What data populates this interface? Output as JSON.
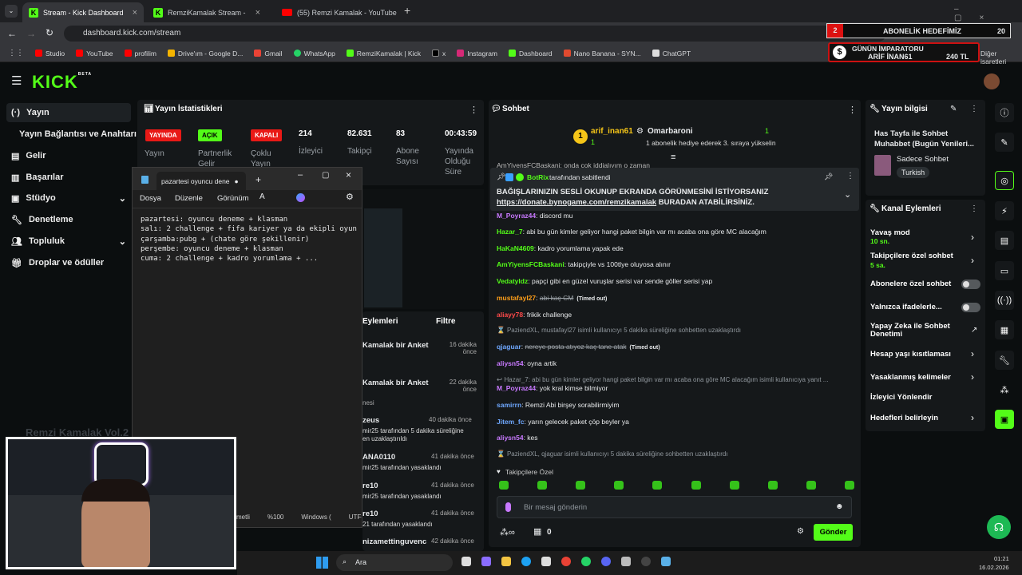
{
  "browser": {
    "tabs": [
      {
        "title": "Stream - Kick Dashboard"
      },
      {
        "title": "RemziKamalak Stream - Wa"
      },
      {
        "title": "(55) Remzi Kamalak - YouTube"
      }
    ],
    "url": "dashboard.kick.com/stream",
    "bookmarks": [
      "Studio",
      "YouTube",
      "profilim",
      "Drive'ım - Google D...",
      "Gmail",
      "WhatsApp",
      "RemziKamalak | Kick",
      "x",
      "Instagram",
      "Dashboard",
      "Nano Banana - SYN...",
      "ChatGPT"
    ],
    "other_bookmarks": "Diğer işaretleri"
  },
  "overlay": {
    "goal_num": "2",
    "goal_label": "ABONELİK HEDEFİMİZ",
    "goal_val": "20",
    "emperor_title": "GÜNÜN İMPARATORU",
    "emperor_name": "ARİF İNAN61",
    "emperor_amount": "240 TL"
  },
  "brand": {
    "logo": "KICK",
    "beta": "BETA"
  },
  "sidebar": {
    "items": [
      "Yayın",
      "Yayın Bağlantısı ve Anahtarı",
      "Gelir",
      "Başarılar",
      "Stüdyo",
      "Denetleme",
      "Topluluk",
      "Droplar ve ödüller"
    ]
  },
  "stats": {
    "title": "Yayın İstatistikleri",
    "badges": [
      {
        "badge": "YAYINDA",
        "label": "Yayın"
      },
      {
        "badge": "AÇIK",
        "label": "Partnerlik Gelir"
      },
      {
        "badge": "KAPALI",
        "label": "Çoklu Yayın"
      }
    ],
    "items": [
      {
        "value": "214",
        "label": "İzleyici"
      },
      {
        "value": "82.631",
        "label": "Takipçi"
      },
      {
        "value": "83",
        "label": "Abone Sayısı"
      },
      {
        "value": "00:43:59",
        "label": "Yayında Olduğu Süre"
      }
    ]
  },
  "notepad": {
    "tab": "pazartesi oyuncu dene",
    "menus": [
      "Dosya",
      "Düzenle",
      "Görünüm"
    ],
    "text": "pazartesi: oyuncu deneme + klasman\nsalı: 2 challenge + fifa kariyer ya da ekipli oyun\nçarşamba:pubg + (chate göre şekillenir)\nperşembe: oyuncu deneme + klasman\ncuma: 2 challenge + kadro yorumlama + ...",
    "status": [
      "metli",
      "%100",
      "Windows (",
      "UTF-8"
    ]
  },
  "events": {
    "title": "Eylemleri",
    "filter": "Filtre",
    "items": [
      {
        "text": "Kamalak bir Anket",
        "time": "16 dakika önce"
      },
      {
        "text": "Kamalak bir Anket",
        "time": "22 dakika önce",
        "sub": "nesi"
      },
      {
        "text": "zeus",
        "time": "40 dakika önce",
        "sub": "mir25 tarafından 5 dakika süreliğine",
        "sub2": "en uzaklaştırıldı"
      },
      {
        "text": "ANA0110",
        "time": "41 dakika önce",
        "sub": "mir25 tarafından yasaklandı"
      },
      {
        "text": "re10",
        "time": "41 dakika önce",
        "sub": "mir25 tarafından yasaklandı"
      },
      {
        "text": "re10",
        "time": "41 dakika önce",
        "sub": "21 tarafından yasaklandı"
      },
      {
        "text": "nizamettinguvenc",
        "time": "42 dakika önce"
      }
    ]
  },
  "webcam": {
    "caption": "Remzi Kamalak Vol.2"
  },
  "chat": {
    "title": "Sohbet",
    "top_gifter": {
      "rank": "1",
      "name": "arif_inan61",
      "count": "1"
    },
    "sub_gift": {
      "name": "Omarbaroni",
      "count": "1",
      "message": "1 abonelik hediye ederek 3. sıraya yükselin"
    },
    "cut_line": "AmYiyensFCBaskani: onda çok iddialıyım o zaman",
    "pinned": {
      "by": "BotRix",
      "by_suffix": "tarafından sabitlendi",
      "text1": "BAĞIŞLARINIZIN SESLİ OKUNUP EKRANDA GÖRÜNMESİNİ İSTİYORSANIZ",
      "link": "https://donate.bynogame.com/remzikamalak",
      "text2": " BURADAN ATABİLİRSİNİZ."
    },
    "messages": [
      {
        "user": "M_Poyraz44",
        "color": "#c879ff",
        "text": "discord mu"
      },
      {
        "user": "Hazar_7",
        "color": "#53fc18",
        "text": "abi bu gün kimler geliyor hangi paket bilgin var mı acaba ona göre MC alacağım"
      },
      {
        "user": "HaKaN4609",
        "color": "#53fc18",
        "text": "kadro yorumlama yapak ede"
      },
      {
        "user": "AmYiyensFCBaskani",
        "color": "#53fc18",
        "text": "takipçiyle vs 100tlye oluyosa alınır"
      },
      {
        "user": "Vedatyldz",
        "color": "#53fc18",
        "text": "papçi gibi en güzel vuruşlar serisi var sende göller serisi yap"
      },
      {
        "user": "mustafayl27",
        "color": "#ff9f1a",
        "text": "abi kaç CM",
        "strike": true,
        "tag": "(Timed out)"
      },
      {
        "user": "aliayy78",
        "color": "#ff4a4a",
        "text": "frikik challenge"
      },
      {
        "sys": true,
        "text": "PaziendXL, mustafayl27 isimli kullanıcıyı 5 dakika süreliğine sohbetten uzaklaştırdı"
      },
      {
        "user": "qjaguar",
        "color": "#6fa8ff",
        "text": "nereye posta atıyoz kaç tane atak",
        "strike": true,
        "tag": "(Timed out)"
      },
      {
        "user": "aliysn54",
        "color": "#c879ff",
        "text": "oyna artik"
      },
      {
        "reply": true,
        "text": "Hazar_7: abi bu gün kimler geliyor hangi paket bilgin var mı acaba ona göre MC alacağım isimli kullanıcıya yanıt ..."
      },
      {
        "user": "M_Poyraz44",
        "color": "#c879ff",
        "text": "yok kral kimse bilmiyor"
      },
      {
        "user": "samirrn",
        "color": "#6fa8ff",
        "text": "Remzi Abi birşey sorabilirmiyim"
      },
      {
        "user": "Jitem_fc",
        "color": "#6fa8ff",
        "text": "yarın gelecek paket çöp beyler ya"
      },
      {
        "user": "aliysn54",
        "color": "#c879ff",
        "text": "kes"
      },
      {
        "sys": true,
        "text": "PaziendXL, qjaguar isimli kullanıcıyı 5 dakika süreliğine sohbetten uzaklaştırdı"
      }
    ],
    "emote_section": "Takipçilere Özel",
    "input_placeholder": "Bir mesaj gönderin",
    "points": "0",
    "send": "Gönder"
  },
  "stream_info": {
    "title": "Yayın bilgisi",
    "stream_title": "Has Tayfa ile Sohbet Muhabbet (Bugün Yenileri...",
    "category": "Sadece Sohbet",
    "tag": "Turkish"
  },
  "channel_actions": {
    "title": "Kanal Eylemleri",
    "items": [
      {
        "label": "Yavaş mod",
        "sub": "10 sn.",
        "control": "chevron"
      },
      {
        "label": "Takipçilere özel sohbet",
        "sub": "5 sa.",
        "control": "chevron"
      },
      {
        "label": "Abonelere özel sohbet",
        "control": "toggle"
      },
      {
        "label": "Yalnızca ifadelerle...",
        "control": "toggle"
      },
      {
        "label": "Yapay Zeka ile Sohbet Denetimi",
        "control": "external"
      },
      {
        "label": "Hesap yaşı kısıtlaması",
        "control": "chevron"
      },
      {
        "label": "Yasaklanmış kelimeler",
        "control": "chevron"
      },
      {
        "label": "İzleyici Yönlendir",
        "control": "none"
      },
      {
        "label": "Hedefleri belirleyin",
        "control": "chevron"
      }
    ]
  },
  "taskbar": {
    "search": "Ara",
    "time": "01:21",
    "date": "16.02.2026"
  },
  "colors": {
    "accent": "#53fc18",
    "live": "#e91916",
    "panel": "#15181a"
  }
}
